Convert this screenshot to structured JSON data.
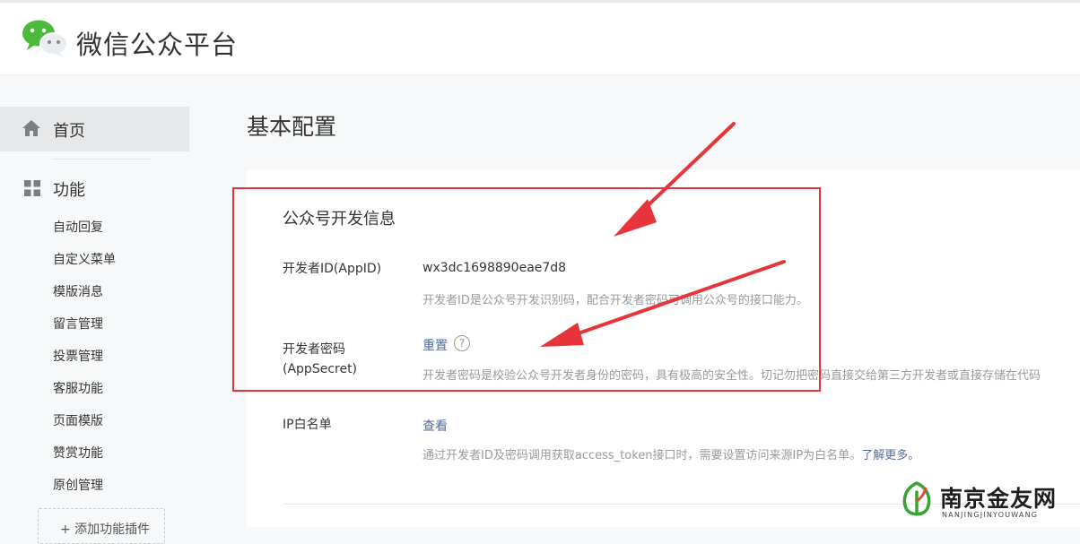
{
  "header": {
    "title": "微信公众平台",
    "logo_icon": "wechat-logo-icon",
    "brand_color": "#4cb93a"
  },
  "sidebar": {
    "home": {
      "label": "首页",
      "icon": "home-icon"
    },
    "features": {
      "label": "功能",
      "icon": "grid-icon",
      "items": [
        {
          "label": "自动回复"
        },
        {
          "label": "自定义菜单"
        },
        {
          "label": "模版消息"
        },
        {
          "label": "留言管理"
        },
        {
          "label": "投票管理"
        },
        {
          "label": "客服功能"
        },
        {
          "label": "页面模版"
        },
        {
          "label": "赞赏功能"
        },
        {
          "label": "原创管理"
        }
      ],
      "add_plugin": "+ 添加功能插件"
    }
  },
  "main": {
    "page_title": "基本配置",
    "section_title": "公众号开发信息",
    "appid": {
      "label": "开发者ID(AppID)",
      "value": "wx3dc1698890eae7d8",
      "desc": "开发者ID是公众号开发识别码，配合开发者密码可调用公众号的接口能力。"
    },
    "appsecret": {
      "label_line1": "开发者密码",
      "label_line2": "(AppSecret)",
      "action": "重置",
      "help_glyph": "?",
      "desc": "开发者密码是校验公众号开发者身份的密码，具有极高的安全性。切记勿把密码直接交给第三方开发者或直接存储在代码"
    },
    "ip_whitelist": {
      "label": "IP白名单",
      "action": "查看",
      "desc": "通过开发者ID及密码调用获取access_token接口时，需要设置访问来源IP为白名单。",
      "desc_link": "了解更多。"
    }
  },
  "annotations": {
    "highlight_color": "#e7343a"
  },
  "watermark": {
    "title": "南京金友网",
    "subtitle": "NANJINGJINYOUWANG",
    "icon": "leaf-logo-icon"
  },
  "colors": {
    "link": "#576b95",
    "muted": "#9a9a9a",
    "sidebar_active": "#e6e8ea"
  }
}
